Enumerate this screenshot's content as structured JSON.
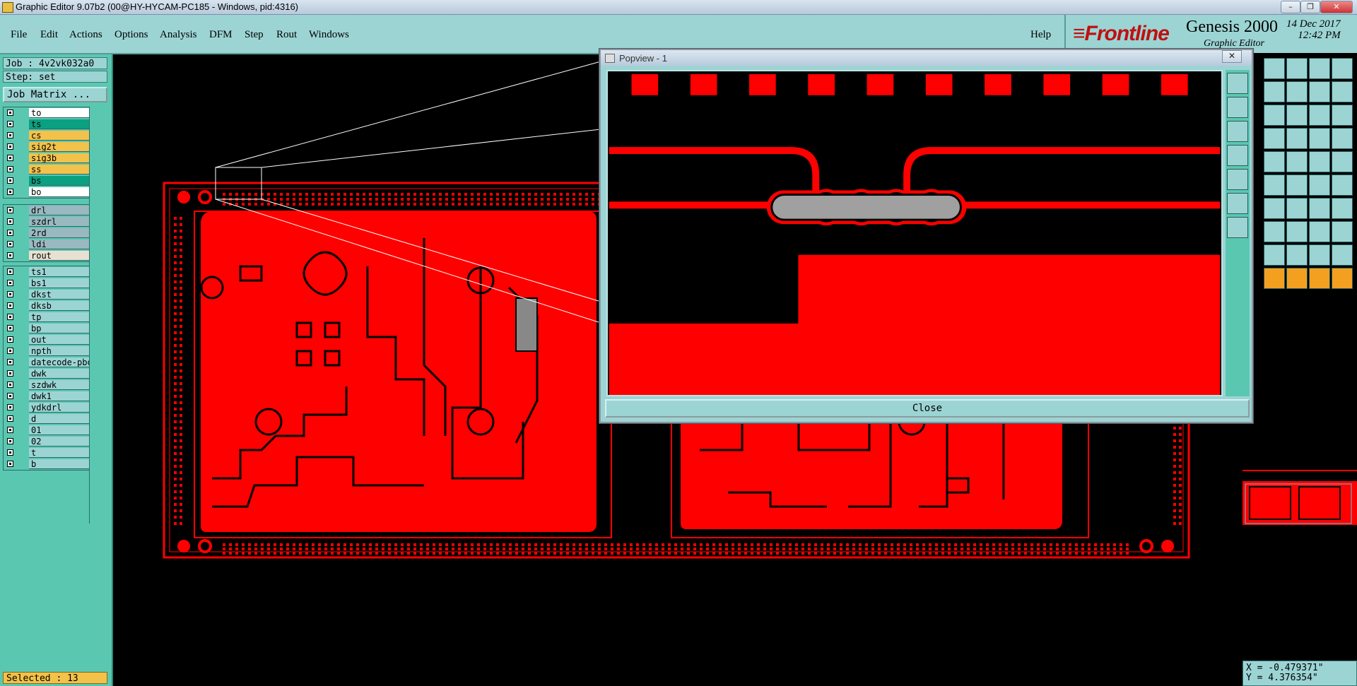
{
  "window": {
    "title": "Graphic Editor 9.07b2 (00@HY-HYCAM-PC185 - Windows, pid:4316)"
  },
  "menu": [
    "File",
    "Edit",
    "Actions",
    "Options",
    "Analysis",
    "DFM",
    "Step",
    "Rout",
    "Windows"
  ],
  "help_label": "Help",
  "brand": {
    "logo": "Frontline",
    "product": "Genesis 2000",
    "subtitle": "Graphic Editor",
    "date": "14 Dec 2017",
    "time": "12:42 PM"
  },
  "job": {
    "name": "Job : 4v2vk032a0",
    "step": "Step: set",
    "matrix_button": "Job Matrix ..."
  },
  "layers_board": [
    {
      "name": "to",
      "color": "#ffffff"
    },
    {
      "name": "ts",
      "color": "#0aa080"
    },
    {
      "name": "cs",
      "color": "#f3c24a"
    },
    {
      "name": "sig2t",
      "color": "#f3c24a"
    },
    {
      "name": "sig3b",
      "color": "#f3c24a"
    },
    {
      "name": "ss",
      "color": "#f3c24a"
    },
    {
      "name": "bs",
      "color": "#0aa080"
    },
    {
      "name": "bo",
      "color": "#ffffff"
    }
  ],
  "layers_drill": [
    {
      "name": "drl",
      "color": "#9ab8c0"
    },
    {
      "name": "szdrl",
      "color": "#9ab8c0"
    },
    {
      "name": "2rd",
      "color": "#9ab8c0"
    },
    {
      "name": "ldi",
      "color": "#9ab8c0"
    },
    {
      "name": "rout",
      "color": "#e8e0d0"
    }
  ],
  "layers_misc": [
    {
      "name": "ts1",
      "color": "#9cd4d4"
    },
    {
      "name": "bs1",
      "color": "#9cd4d4"
    },
    {
      "name": "dkst",
      "color": "#9cd4d4"
    },
    {
      "name": "dksb",
      "color": "#9cd4d4"
    },
    {
      "name": "tp",
      "color": "#9cd4d4"
    },
    {
      "name": "bp",
      "color": "#9cd4d4"
    },
    {
      "name": "out",
      "color": "#9cd4d4"
    },
    {
      "name": "npth",
      "color": "#9cd4d4"
    },
    {
      "name": "datecode-pbo",
      "color": "#9cd4d4"
    },
    {
      "name": "dwk",
      "color": "#9cd4d4"
    },
    {
      "name": "szdwk",
      "color": "#9cd4d4"
    },
    {
      "name": "dwk1",
      "color": "#9cd4d4"
    },
    {
      "name": "ydkdrl",
      "color": "#9cd4d4"
    },
    {
      "name": "d",
      "color": "#9cd4d4"
    },
    {
      "name": "01",
      "color": "#9cd4d4"
    },
    {
      "name": "02",
      "color": "#9cd4d4"
    },
    {
      "name": "t",
      "color": "#9cd4d4"
    },
    {
      "name": "b",
      "color": "#9cd4d4"
    }
  ],
  "selected": "Selected : 13",
  "popup": {
    "title": "Popview - 1",
    "close_label": "Close"
  },
  "coords": {
    "x": "X = -0.479371\"",
    "y": "Y = 4.376354\""
  },
  "colors": {
    "copper": "#ff0000",
    "panel": "#9cd4d4",
    "left_panel": "#5ac8b0"
  }
}
